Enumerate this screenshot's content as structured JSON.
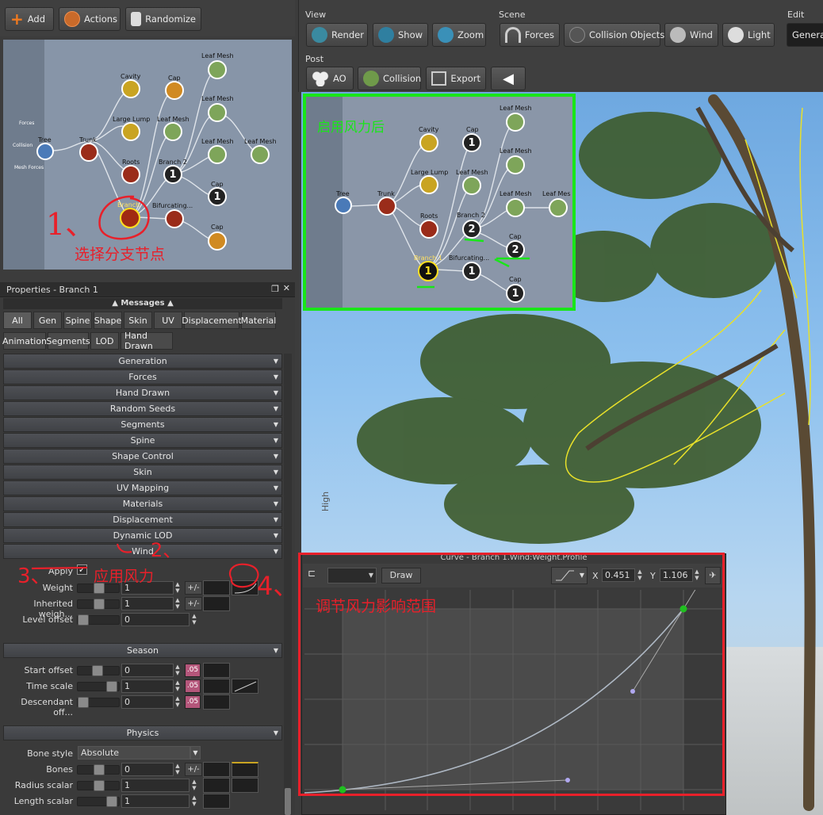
{
  "toolbar_left": {
    "add": "Add",
    "actions": "Actions",
    "randomize": "Randomize"
  },
  "view_group": {
    "label": "View",
    "render": "Render",
    "show": "Show",
    "zoom": "Zoom"
  },
  "scene_group": {
    "label": "Scene",
    "forces": "Forces",
    "collision_objects": "Collision Objects",
    "wind": "Wind",
    "light": "Light"
  },
  "edit_group": {
    "label": "Edit",
    "generate": "Generat"
  },
  "post_group": {
    "label": "Post",
    "ao": "AO",
    "collision": "Collision",
    "export": "Export"
  },
  "graph_left": {
    "nodes": {
      "tree": "Tree",
      "trunk": "Trunk",
      "cavity": "Cavity",
      "large_lump": "Large Lump",
      "roots": "Roots",
      "branch": "Branch",
      "cap1": "Cap",
      "leaf_mesh1": "Leaf Mesh",
      "leaf_mesh2": "Leaf Mesh",
      "leaf_mesh3": "Leaf Mesh",
      "leaf_mesh4": "Leaf Mesh",
      "leaf_mesh5": "Leaf Mesh",
      "branch2": "Branch 2",
      "cap2": "Cap",
      "bifurcating": "Bifurcating...",
      "cap3": "Cap",
      "badge1": "1",
      "badge2": "1"
    },
    "side_labels": [
      "Forces",
      "Collision",
      "Mesh Forces"
    ]
  },
  "graph_right": {
    "nodes": {
      "tree": "Tree",
      "trunk": "Trunk",
      "cavity": "Cavity",
      "large_lump": "Large Lump",
      "roots": "Roots",
      "branch1": "Branch 1",
      "cap1": "Cap",
      "leaf_mesh1": "Leaf Mesh",
      "leaf_mesh2": "Leaf Mesh",
      "leaf_mesh3": "Leaf Mesh",
      "leaf_mesh4": "Leaf Mes",
      "leaf_mesh5": "Leaf Mesh",
      "branch2": "Branch 2",
      "cap2": "Cap",
      "bifurcating": "Bifurcating...",
      "cap3": "Cap"
    },
    "badges": {
      "cap1": "1",
      "branch2": "2",
      "cap2": "2",
      "branch1": "1",
      "bifurcating": "1",
      "cap3": "1"
    }
  },
  "annotations": {
    "step1": "1、",
    "select_branch": "选择分支节点",
    "wind_enabled": "启用风力后",
    "step2": "2、",
    "step3": "3、",
    "apply_wind": "应用风力",
    "step4": "4、",
    "adjust_range": "调节风力影响范围"
  },
  "properties": {
    "title": "Properties - Branch 1",
    "messages": "Messages",
    "tabs_row1": [
      "All",
      "Gen",
      "Spine",
      "Shape",
      "Skin",
      "UV",
      "Displacement",
      "Material"
    ],
    "tabs_row2": [
      "Animation",
      "Segments",
      "LOD",
      "Hand Drawn"
    ],
    "sections": [
      "Generation",
      "Forces",
      "Hand Drawn",
      "Random Seeds",
      "Segments",
      "Spine",
      "Shape Control",
      "Skin",
      "UV Mapping",
      "Materials",
      "Displacement",
      "Dynamic LOD",
      "Wind"
    ],
    "wind": {
      "apply": "Apply",
      "weight": "Weight",
      "weight_val": "1",
      "inherited": "Inherited weigh...",
      "inherited_val": "1",
      "level_offset": "Level offset",
      "level_offset_val": "0"
    },
    "season": {
      "title": "Season",
      "start_offset": "Start offset",
      "start_offset_val": "0",
      "time_scale": "Time scale",
      "time_scale_val": "1",
      "descendant": "Descendant off...",
      "descendant_val": "0",
      "pink": ".05"
    },
    "physics": {
      "title": "Physics",
      "bone_style": "Bone style",
      "bone_style_val": "Absolute",
      "bones": "Bones",
      "bones_val": "0",
      "radius_scalar": "Radius scalar",
      "radius_val": "1",
      "length_scalar": "Length scalar",
      "length_val": "1"
    },
    "plusminus": "+/-"
  },
  "curve": {
    "title": "Curve - Branch 1.Wind:Weight.Profile",
    "draw": "Draw",
    "x_label": "X",
    "x_val": "0.451",
    "y_label": "Y",
    "y_val": "1.106"
  },
  "viewport": {
    "side_text": "High"
  },
  "colors": {
    "accent_green": "#19e619",
    "annotation_red": "#e8202a",
    "panel": "#3c3c3c"
  }
}
